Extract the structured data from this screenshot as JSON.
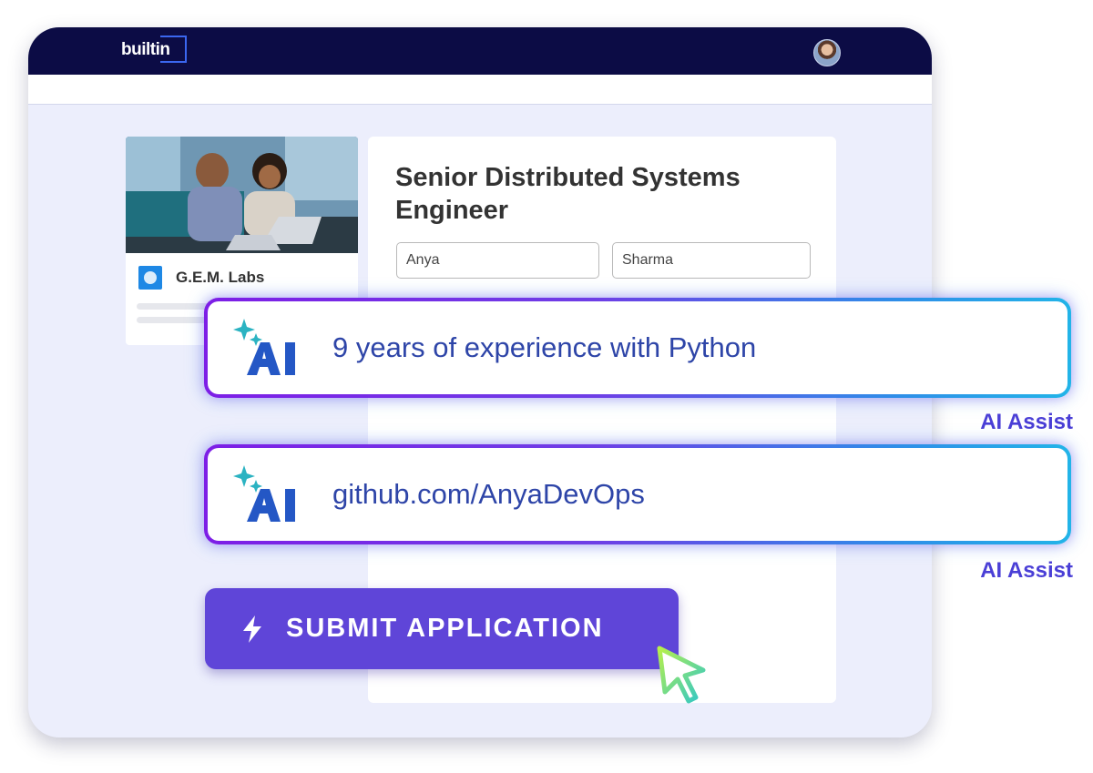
{
  "header": {
    "logo_text": "builtin",
    "logo_icon": "builtin-logo",
    "avatar_icon": "user-avatar"
  },
  "company": {
    "name": "G.E.M. Labs",
    "logo_icon": "company-logo",
    "photo": "two people at laptop"
  },
  "job": {
    "title": "Senior Distributed Systems Engineer",
    "first_name": "Anya",
    "last_name": "Sharma"
  },
  "ai_suggestions": [
    {
      "text": "9 years of experience with Python",
      "label": "AI Assist",
      "icon": "ai-sparkle-icon"
    },
    {
      "text": "github.com/AnyaDevOps",
      "label": "AI Assist",
      "icon": "ai-sparkle-icon"
    }
  ],
  "submit": {
    "label": "SUBMIT APPLICATION",
    "icon": "lightning-bolt-icon"
  },
  "colors": {
    "topbar": "#0c0c45",
    "accent": "#5f45d8",
    "ai_gradient_start": "#7d1ee6",
    "ai_gradient_end": "#22b4e8",
    "ai_text": "#2e45a8",
    "ai_label": "#4a3fd6"
  }
}
